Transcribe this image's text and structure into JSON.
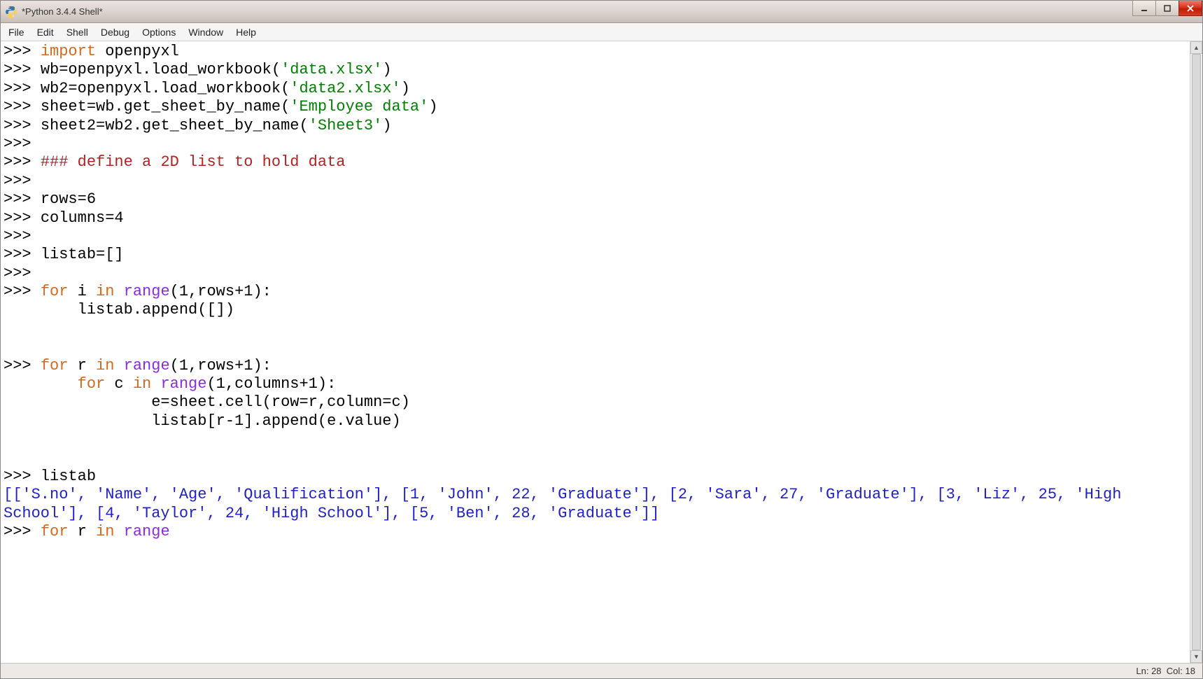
{
  "window": {
    "title": "*Python 3.4.4 Shell*"
  },
  "menubar": {
    "items": [
      "File",
      "Edit",
      "Shell",
      "Debug",
      "Options",
      "Window",
      "Help"
    ]
  },
  "code": {
    "prompt": ">>> ",
    "l1_a": "import",
    "l1_b": " openpyxl",
    "l2_a": "wb=openpyxl.load_workbook(",
    "l2_b": "'data.xlsx'",
    "l2_c": ")",
    "l3_a": "wb2=openpyxl.load_workbook(",
    "l3_b": "'data2.xlsx'",
    "l3_c": ")",
    "l4_a": "sheet=wb.get_sheet_by_name(",
    "l4_b": "'Employee data'",
    "l4_c": ")",
    "l5_a": "sheet2=wb2.get_sheet_by_name(",
    "l5_b": "'Sheet3'",
    "l5_c": ")",
    "l7": "### define a 2D list to hold data",
    "l9": "rows=6",
    "l10": "columns=4",
    "l12": "listab=[]",
    "l14_a": "for",
    "l14_b": " i ",
    "l14_c": "in",
    "l14_d": " ",
    "l14_e": "range",
    "l14_f": "(1,rows+1):",
    "l15": "        listab.append([])",
    "l18_a": "for",
    "l18_b": " r ",
    "l18_c": "in",
    "l18_d": " ",
    "l18_e": "range",
    "l18_f": "(1,rows+1):",
    "l19_a": "        ",
    "l19_b": "for",
    "l19_c": " c ",
    "l19_d": "in",
    "l19_e": " ",
    "l19_f": "range",
    "l19_g": "(1,columns+1):",
    "l20": "                e=sheet.cell(row=r,column=c)",
    "l21": "                listab[r-1].append(e.value)",
    "l23": "listab",
    "l24": "[['S.no', 'Name', 'Age', 'Qualification'], [1, 'John', 22, 'Graduate'], [2, 'Sara', 27, 'Graduate'], [3, 'Liz', 25, 'High School'], [4, 'Taylor', 24, 'High School'], [5, 'Ben', 28, 'Graduate']]",
    "l25_a": "for",
    "l25_b": " r ",
    "l25_c": "in",
    "l25_d": " ",
    "l25_e": "range"
  },
  "status": {
    "ln_label": "Ln:",
    "ln": "28",
    "col_label": "Col:",
    "col": "18"
  },
  "chart_data": {
    "type": "table",
    "columns": [
      "S.no",
      "Name",
      "Age",
      "Qualification"
    ],
    "rows": [
      [
        1,
        "John",
        22,
        "Graduate"
      ],
      [
        2,
        "Sara",
        27,
        "Graduate"
      ],
      [
        3,
        "Liz",
        25,
        "High School"
      ],
      [
        4,
        "Taylor",
        24,
        "High School"
      ],
      [
        5,
        "Ben",
        28,
        "Graduate"
      ]
    ],
    "variables": {
      "rows": 6,
      "columns": 4
    }
  }
}
